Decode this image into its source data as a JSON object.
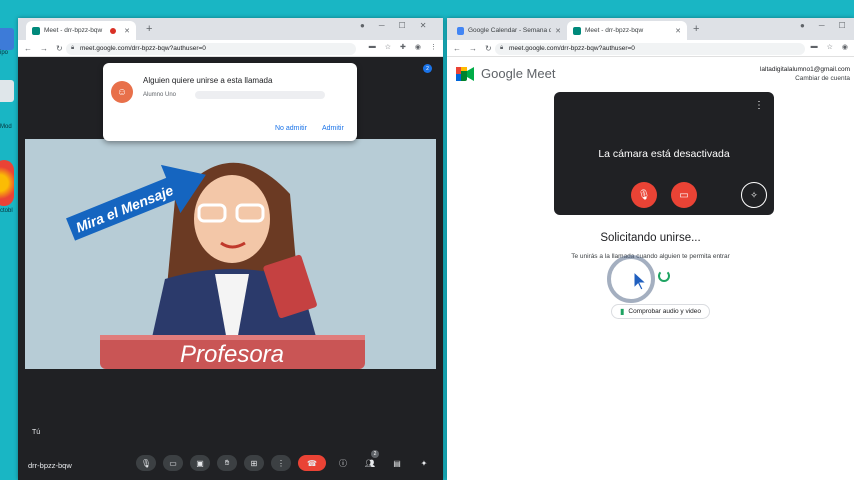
{
  "desktop": {
    "labels": [
      "ipo",
      "Mod",
      "ctobl"
    ]
  },
  "left_window": {
    "tab_title": "Meet - drr-bpzz-bqw",
    "url": "meet.google.com/drr-bpzz-bqw?authuser=0",
    "popup": {
      "title": "Alguien quiere unirse a esta llamada",
      "requester": "Alumno Uno",
      "deny_label": "No admitir",
      "admit_label": "Admitir"
    },
    "annotation": "Mira el Mensaje",
    "tile_label": "Profesora",
    "self_label": "Tú",
    "meeting_code": "drr-bpzz-bqw",
    "participants_count": "2",
    "people_badge": "2"
  },
  "right_window": {
    "tabs": [
      {
        "title": "Google Calendar - Semana del 5"
      },
      {
        "title": "Meet - drr-bpzz-bqw"
      }
    ],
    "url": "meet.google.com/drr-bpzz-bqw?authuser=0",
    "brand": "Google Meet",
    "account_email": "laltadigitalalumno1@gmail.com",
    "account_switch": "Cambiar de cuenta",
    "camera_off": "La cámara está desactivada",
    "requesting": "Solicitando unirse...",
    "requesting_sub": "Te unirás a la llamada cuando alguien te permita entrar",
    "check_av": "Comprobar audio y video"
  },
  "colors": {
    "desktop_bg": "#19b6c4",
    "meet_dark": "#202124",
    "end_call": "#ea4335",
    "link_blue": "#1a73e8",
    "annotation_blue": "#1565c0"
  }
}
